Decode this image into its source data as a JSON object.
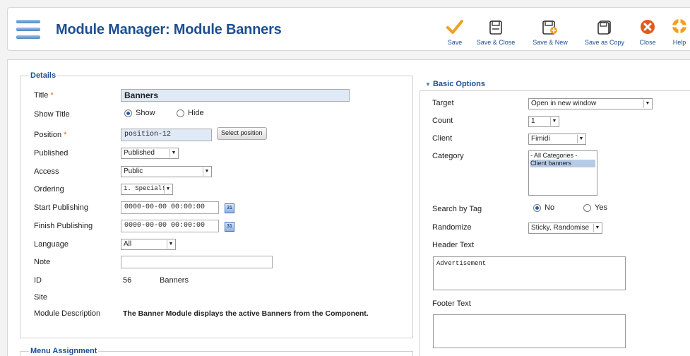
{
  "header": {
    "title": "Module Manager: Module Banners",
    "buttons": [
      {
        "label": "Save",
        "icon": "check-icon"
      },
      {
        "label": "Save & Close",
        "icon": "save-close-icon"
      },
      {
        "label": "Save & New",
        "icon": "save-new-icon"
      },
      {
        "label": "Save as Copy",
        "icon": "save-copy-icon"
      },
      {
        "label": "Close",
        "icon": "close-icon"
      },
      {
        "label": "Help",
        "icon": "help-icon"
      }
    ]
  },
  "details": {
    "legend": "Details",
    "title_label": "Title",
    "title_value": "Banners",
    "show_title_label": "Show Title",
    "show_option": "Show",
    "hide_option": "Hide",
    "position_label": "Position",
    "position_value": "position-12",
    "select_position": "Select position",
    "published_label": "Published",
    "published_value": "Published",
    "access_label": "Access",
    "access_value": "Public",
    "ordering_label": "Ordering",
    "ordering_value": "1. Special!",
    "start_publishing_label": "Start Publishing",
    "start_publishing_value": "0000-00-00 00:00:00",
    "finish_publishing_label": "Finish Publishing",
    "finish_publishing_value": "0000-00-00 00:00:00",
    "language_label": "Language",
    "language_value": "All",
    "note_label": "Note",
    "note_value": "",
    "id_label": "ID",
    "id_value": "56",
    "id_name": "Banners",
    "site_label": "Site",
    "module_description_label": "Module Description",
    "module_description_value": "The Banner Module displays the active Banners from the Component.",
    "required_mark": "*",
    "calendar_glyph": "31"
  },
  "menu_assignment": {
    "legend": "Menu Assignment"
  },
  "basic_options": {
    "title": "Basic Options",
    "target_label": "Target",
    "target_value": "Open in new window",
    "count_label": "Count",
    "count_value": "1",
    "client_label": "Client",
    "client_value": "Fimidi",
    "category_label": "Category",
    "category_options": [
      "- All Categories -",
      "Client banners"
    ],
    "search_by_tag_label": "Search by Tag",
    "search_no": "No",
    "search_yes": "Yes",
    "randomize_label": "Randomize",
    "randomize_value": "Sticky, Randomise",
    "header_text_label": "Header Text",
    "header_text_value": "Advertisement",
    "footer_text_label": "Footer Text",
    "footer_text_value": ""
  }
}
